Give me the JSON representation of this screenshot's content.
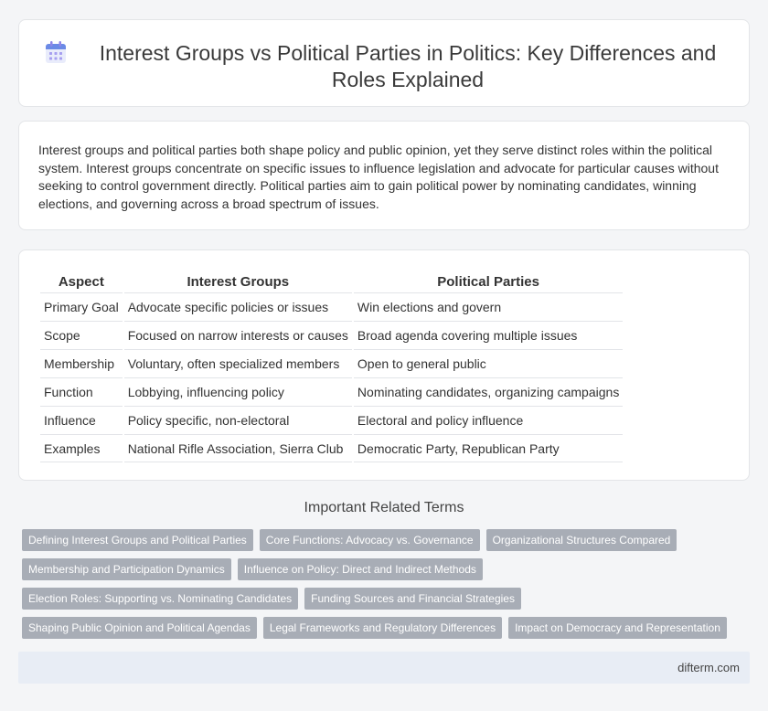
{
  "header": {
    "title": "Interest Groups vs Political Parties in Politics: Key Differences and Roles Explained",
    "icon": "calendar-icon"
  },
  "intro": {
    "text": "Interest groups and political parties both shape policy and public opinion, yet they serve distinct roles within the political system. Interest groups concentrate on specific issues to influence legislation and advocate for particular causes without seeking to control government directly. Political parties aim to gain political power by nominating candidates, winning elections, and governing across a broad spectrum of issues."
  },
  "table": {
    "headers": [
      "Aspect",
      "Interest Groups",
      "Political Parties"
    ],
    "rows": [
      [
        "Primary Goal",
        "Advocate specific policies or issues",
        "Win elections and govern"
      ],
      [
        "Scope",
        "Focused on narrow interests or causes",
        "Broad agenda covering multiple issues"
      ],
      [
        "Membership",
        "Voluntary, often specialized members",
        "Open to general public"
      ],
      [
        "Function",
        "Lobbying, influencing policy",
        "Nominating candidates, organizing campaigns"
      ],
      [
        "Influence",
        "Policy specific, non-electoral",
        "Electoral and policy influence"
      ],
      [
        "Examples",
        "National Rifle Association, Sierra Club",
        "Democratic Party, Republican Party"
      ]
    ]
  },
  "related": {
    "title": "Important Related Terms",
    "tags": [
      [
        "Defining Interest Groups and Political Parties",
        "Core Functions: Advocacy vs. Governance",
        "Organizational Structures Compared"
      ],
      [
        "Membership and Participation Dynamics",
        "Influence on Policy: Direct and Indirect Methods"
      ],
      [
        "Election Roles: Supporting vs. Nominating Candidates",
        "Funding Sources and Financial Strategies"
      ],
      [
        "Shaping Public Opinion and Political Agendas",
        "Legal Frameworks and Regulatory Differences",
        "Impact on Democracy and Representation"
      ]
    ]
  },
  "footer": {
    "domain": "difterm.com"
  },
  "colors": {
    "tag_bg": "#a8adb6",
    "footer_bg": "#e8edf5",
    "icon_blue": "#5b7be0",
    "icon_purple": "#8f86e8"
  }
}
